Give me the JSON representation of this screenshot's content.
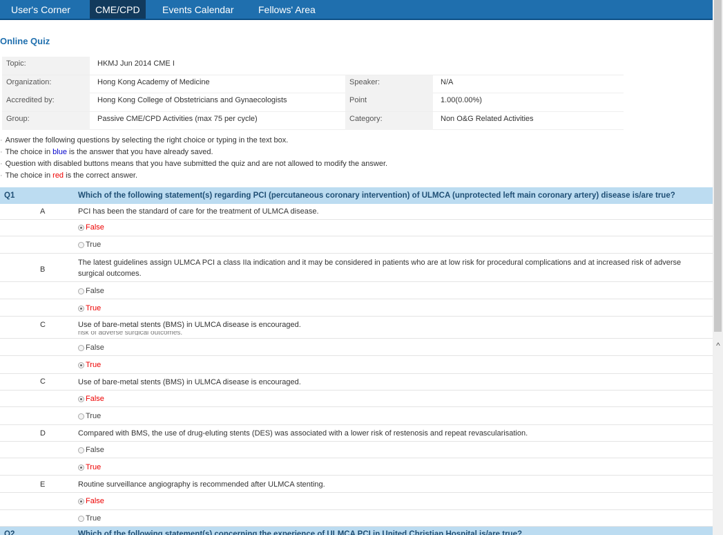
{
  "nav": {
    "items": [
      {
        "label": "User's Corner",
        "active": false
      },
      {
        "label": "CME/CPD",
        "active": true
      },
      {
        "label": "Events Calendar",
        "active": false
      },
      {
        "label": "Fellows' Area",
        "active": false
      }
    ]
  },
  "page_title": "Online Quiz",
  "info": {
    "topic_label": "Topic:",
    "topic": "HKMJ Jun 2014 CME I",
    "org_label": "Organization:",
    "org": "Hong Kong Academy of Medicine",
    "speaker_label": "Speaker:",
    "speaker": "N/A",
    "accredited_label": "Accredited by:",
    "accredited": "Hong Kong College of Obstetricians and Gynaecologists",
    "point_label": "Point",
    "point": "1.00(0.00%)",
    "group_label": "Group:",
    "group": "Passive CME/CPD Activities (max 75 per cycle)",
    "category_label": "Category:",
    "category": "Non O&G Related Activities"
  },
  "notes": {
    "n1": "Answer the following questions by selecting the right choice or typing in the text box.",
    "n2_pre": "The choice in ",
    "n2_color": "blue",
    "n2_post": " is the answer that you have already saved.",
    "n3": "Question with disabled buttons means that you have submitted the quiz and are not allowed to modify the answer.",
    "n4_pre": "The choice in ",
    "n4_color": "red",
    "n4_post": " is the correct answer."
  },
  "q1": {
    "number": "Q1",
    "text": "Which of the following statement(s) regarding PCI (percutaneous coronary intervention) of ULMCA (unprotected left main coronary artery) disease is/are true?",
    "items": [
      {
        "letter": "A",
        "stmt": "PCI has been the standard of care for the treatment of ULMCA disease.",
        "opt1": "False",
        "opt2": "True"
      },
      {
        "letter": "B",
        "stmt": "The latest guidelines assign ULMCA PCI a class IIa indication and it may be considered in patients who are at low risk for procedural complications and at increased risk of adverse surgical outcomes.",
        "opt1": "False",
        "opt2": "True"
      },
      {
        "letter": "C",
        "stmt": "Use of bare-metal stents (BMS) in ULMCA disease is encouraged.",
        "ghost": "risk of adverse surgical outcomes.",
        "opt1": "False",
        "opt2": "True"
      },
      {
        "letter": "C",
        "stmt": "Use of bare-metal stents (BMS) in ULMCA disease is encouraged.",
        "opt1": "False",
        "opt2": "True"
      },
      {
        "letter": "D",
        "stmt": "Compared with BMS, the use of drug-eluting stents (DES) was associated with a lower risk of restenosis and repeat revascularisation.",
        "opt1": "False",
        "opt2": "True"
      },
      {
        "letter": "E",
        "stmt": "Routine surveillance angiography is recommended after ULMCA stenting.",
        "opt1": "False",
        "opt2": "True"
      }
    ]
  },
  "q2": {
    "number": "Q2",
    "text": "Which of the following statement(s) concerning the experience of ULMCA PCI in United Christian Hospital is/are true?"
  },
  "scroll_up_icon": "chevron-up-icon"
}
